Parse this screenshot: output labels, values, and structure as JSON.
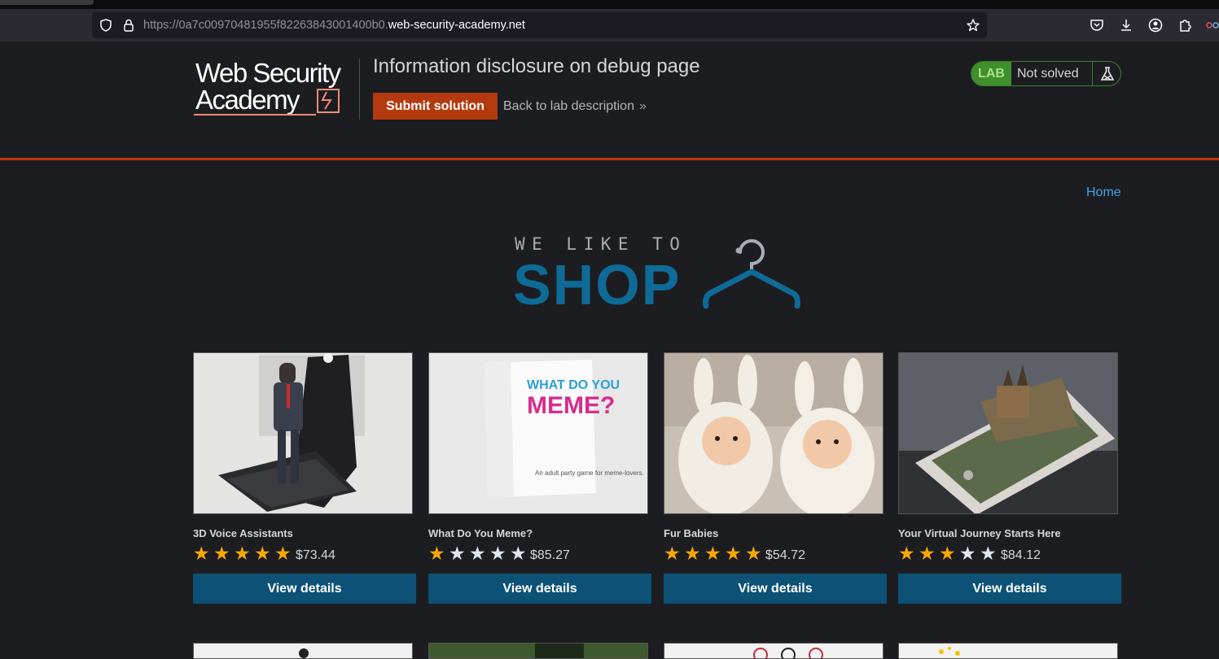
{
  "browser": {
    "url_prefix": "https://0a7c00970481955f82263843001400b0.",
    "url_domain": "web-security-academy.net",
    "icons": [
      "shield-icon",
      "lock-icon",
      "star-bookmark-icon",
      "pocket-icon",
      "download-icon",
      "account-icon",
      "extensions-icon",
      "more-icon"
    ]
  },
  "lab": {
    "title": "Information disclosure on debug page",
    "submit_label": "Submit solution",
    "back_label": "Back to lab description",
    "back_chevron": "»",
    "badge_label": "LAB",
    "status": "Not solved",
    "logo_text": "Web Security Academy"
  },
  "nav": {
    "home": "Home"
  },
  "banner": {
    "tagline": "WE LIKE TO",
    "word": "SHOP"
  },
  "products": [
    {
      "name": "3D Voice Assistants",
      "rating": 5,
      "price": "$73.44",
      "button": "View details"
    },
    {
      "name": "What Do You Meme?",
      "rating": 1,
      "price": "$85.27",
      "button": "View details"
    },
    {
      "name": "Fur Babies",
      "rating": 5,
      "price": "$54.72",
      "button": "View details"
    },
    {
      "name": "Your Virtual Journey Starts Here",
      "rating": 3,
      "price": "$84.12",
      "button": "View details"
    }
  ],
  "meme_box": {
    "line1": "WHAT DO YOU",
    "line2": "MEME?",
    "caption": "An adult party game for meme-lovers."
  },
  "colors": {
    "accent_orange": "#c1350b",
    "button_blue": "#0d5176",
    "star": "#f6a800",
    "status_green": "#3f8f2b",
    "link_blue": "#3ea3e8"
  }
}
